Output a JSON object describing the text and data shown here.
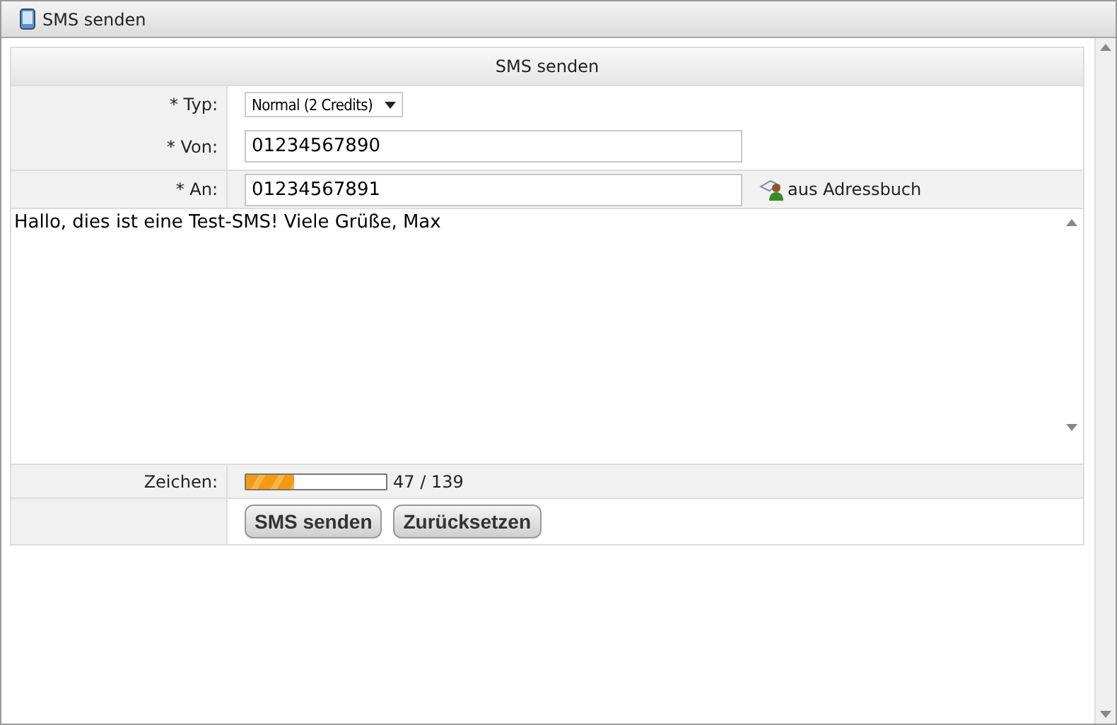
{
  "window": {
    "title": "SMS senden"
  },
  "form": {
    "heading": "SMS senden",
    "type": {
      "label": "* Typ:",
      "value": "Normal (2 Credits)"
    },
    "from": {
      "label": "* Von:",
      "value": "01234567890"
    },
    "to": {
      "label": "* An:",
      "value": "01234567891",
      "addressbook": "aus Adressbuch"
    },
    "message": "Hallo, dies ist eine Test-SMS! Viele Grüße, Max",
    "chars": {
      "label": "Zeichen:",
      "level": 0.34,
      "reading": "47 / 139"
    },
    "buttons": [
      "SMS senden",
      "Zurücksetzen"
    ]
  }
}
